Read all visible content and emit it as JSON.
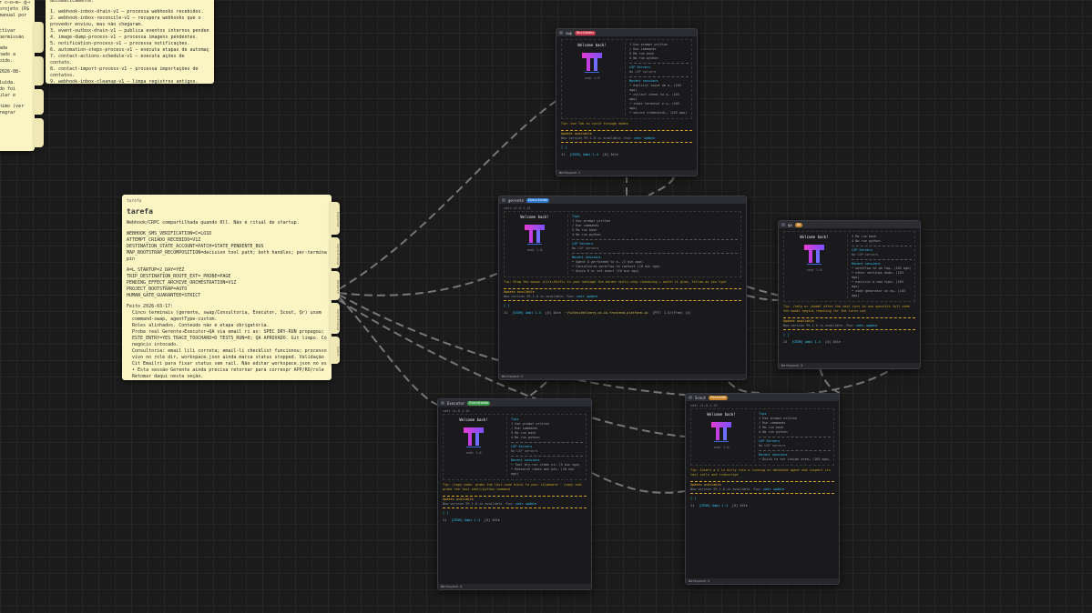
{
  "note_top_left": {
    "lines": [
      "r c̶o̶m̶ ĝ̶e̶ e",
      "projeto (R$,",
      "manual por",
      "",
      "",
      "ctivar",
      "permissão",
      "",
      "ada",
      "nado a",
      "pido.",
      "",
      "2026-08-",
      "",
      "luída.",
      "do foi",
      "ular e",
      "",
      "nimo (ver",
      "regrar"
    ]
  },
  "note_top": {
    "lines": [
      "automaticamente.",
      "",
      "1. webhook-inbox-drain-v1 — processa webhooks recebidos.",
      "2. webhook-inbox-reconcile-v1 — recupera webhooks que o",
      "provedor enviou, mas não chegaram.",
      "3. event-outbox-drain-v1 — publica eventos internos pendentes.",
      "4. image-dump-process-v1 — processa imagens pendentes.",
      "5. notification-process-v1 — processa notificações.",
      "6. automation-steps-process-v1 — executa etapas de automação.",
      "7. contact-actions-schedule-v1 — executa ações de",
      "contato.",
      "8. contact-import-process-v1 — processa importações de",
      "contatos.",
      "9. webhook-inbox-cleanup-v1 — limpa registros antigos."
    ]
  },
  "note_main": {
    "label": "tarefa",
    "title": "tarefa",
    "blocks": [
      [
        "Webhook/CRPC compartilhada quando 0ll. Não é ritual de startup."
      ],
      [
        "WEBHOOK_SMS_VERIFICATION=C=LO1D",
        "ATTEMPT_CRIADO_RECEBIDO=V1Z",
        "DESTINATION_STATE_ACCOUNT=PATCH=STATE_PENDENTE_BUS",
        "MAP_BOOTSTRAP_RECOMPOSITION=decision tool path; both handles; per-terminal model",
        "pin"
      ],
      [
        "A=L_STARTUP=2_DAY=YEZ",
        "TRIP_DESTINATION_ROUTE_EXT=_PROBE=PAGE",
        "PENDING_EFFECT_ARCHIVE_ORCHESTRATION=V1Z",
        "PROJECT_BOOTSTRAP=AUTO",
        "HUMAN_GATE_GUARANTEE=STRICT"
      ],
      [
        "Feito 2026-03-17:",
        "  Cinco terminais (gerente, swap/Consultoria, Executor, Scout, Qr) usam",
        "  command-swap, agentType-custom.",
        "  Roles alinhados. Conteúdo não é etapa obrigatória.",
        "  Probe real Gerente→Executor→QA via email ri as: SPEC DRY-RUN propagou; Executor",
        "  ESTE_ENTRY=YES TRACE_TOOCHARD=D TESTS_RUN=0; QA APROVADO. Git limpo. Código de",
        "  negócio intocado.",
        "  Consultoria: email lili correta; email-li checklist funcionou; processo QAP",
        "  vivo no role dir, workspace.json ainda marca status stopped. Validação clara. Sem",
        "  Cit Emailri para fixar status sem rail. Não editar workspace.json no escuro.",
        "  • Esta sessão Gerente ainda precisa retornar para correspr APP/RO/role finais.",
        "  Retomar daqui nesta seção."
      ]
    ],
    "tabs": [
      "Executor",
      "Consultoria",
      "Gerente",
      "Consultoria",
      "Scout"
    ]
  },
  "terminals": [
    {
      "id": "term-swp",
      "title": "swp",
      "badge": "Novidades",
      "badge_color": "red",
      "version": "",
      "welcome": "Welcome back!",
      "model": "cedr 1.0",
      "tips_title": "",
      "tips": [
        "1 Use prompt written",
        "/ Run commands",
        "3 Mo run bash",
        "4 No run python"
      ],
      "lsp_title": "LSP Servers",
      "lsp": "No LSP servers",
      "recent_title": "Recent sessions",
      "recent": [
        "• explicit input do o… (103 ago)",
        "• collect items to e… (163 ago)",
        "• index terminal e n… (163 ago)",
        "• secure credential… (163 ago)"
      ],
      "tip": "Tip: Use Tab to cycle through modes",
      "update_h": "Update available",
      "update_b": "New version 99.1.0 is available. Run:",
      "update_cmd": "cedr update",
      "status": [
        "J1",
        "[CEDR] Ambi 1.4",
        "[U] Idle"
      ],
      "footer": "Workspace-1"
    },
    {
      "id": "term-gerente",
      "title": "gerente",
      "badge": "Executando",
      "badge_color": "blue",
      "version": "cedr v1.0.1-15",
      "welcome": "Welcome back!",
      "model": "cedr 1.0",
      "tips_title": "Tips",
      "tips": [
        "1 Use prompt written",
        "/ Run commands",
        "3 Mo run bash",
        "4 No run python"
      ],
      "lsp_title": "LSP Servers",
      "lsp": "No LSP servers",
      "recent_title": "Recent sessions",
      "recent": [
        "• Agent A performed to e… (5 min ago)",
        "• Consultoria workflow to context (10 min ago)",
        "• Quick R or set exact (10 min ago)"
      ],
      "tip": "Tip: Drag the mouse +Ctrl+Shift+ in your message the border multi-step reasoning + watch it glow, follow as you type",
      "update_h": "Update available",
      "update_b": "New version 99.1.0 is available. Run:",
      "update_cmd": "cedr update",
      "status": [
        "J1",
        "[CEDR] Ambi 1.4",
        "[U] Idle",
        "~/sites/delivery-os-io-frontend-platform.io",
        "[PTT: 1.5/(Free) (4)"
      ],
      "footer": "Workspace-2"
    },
    {
      "id": "term-qa",
      "title": "qa",
      "badge": "QA",
      "badge_color": "orange",
      "version": "",
      "welcome": "Welcome back!",
      "model": "cedr 1.0",
      "tips_title": "",
      "tips": [
        "3 Mo run bash",
        "4 No run python"
      ],
      "lsp_title": "LSP Servers",
      "lsp": "No LSP servers",
      "recent_title": "Recent sessions",
      "recent": [
        "• workflow to do tag… (103 ago)",
        "• other settings mode… (163 ago)",
        "• explicit a new type… (163 ago)",
        "• code generator un no… (163 ago)"
      ],
      "tip": "Tip: /help or /model after the next turn to use specific full when the model begins reaching for the turns use",
      "update_h": "Update available",
      "update_b": "New version 99.1.0 is available. Run:",
      "update_cmd": "cedr update",
      "status": [
        "J1",
        "[CEDR] Ambi 1.4",
        "[U] Idle"
      ],
      "footer": "Workspace-3"
    },
    {
      "id": "term-executor",
      "title": "Executor",
      "badge": "Executando",
      "badge_color": "green",
      "version": "cedr v1.0.1-15",
      "welcome": "Welcome back!",
      "model": "cedr 1.0",
      "tips_title": "Tips",
      "tips": [
        "1 Use prompt written",
        "/ Run commands",
        "3 Mo run bash",
        "4 No run python"
      ],
      "lsp_title": "LSP Servers",
      "lsp": "No LSP servers",
      "recent_title": "Recent sessions",
      "recent": [
        "• Tool dry-run items st… (5 min ago)",
        "• Research rakes mes pal… (10 min ago)"
      ],
      "tip": "Tip: /copy code: grabs the last code block to your clipboard · /copy cmd: grabs the last shell/python command",
      "update_h": "Update available",
      "update_b": "New version 99.1.0 is available. Run:",
      "update_cmd": "cedr update",
      "status": [
        "J1",
        "[CEDR] Ambi 1.4",
        "[U] Idle"
      ],
      "footer": "Workspace-4"
    },
    {
      "id": "term-scout",
      "title": "Scout",
      "badge": "Pensando",
      "badge_color": "orange",
      "version": "cedr v1.0.1-15",
      "welcome": "Welcome back!",
      "model": "cedr 1.0",
      "tips_title": "Tips",
      "tips": [
        "1 Use prompt written",
        "/ Run commands",
        "3 Mo run bash",
        "4 No run python"
      ],
      "lsp_title": "LSP Servers",
      "lsp": "No LSP servers",
      "recent_title": "Recent sessions",
      "recent": [
        "• Quick to ret inside area… (103 ago)"
      ],
      "tip": "Tip: Insert a 4 to dirty into a running or detached agent and inspect its tool calls and transcript",
      "update_h": "Update available",
      "update_b": "New version 99.1.0 is available. Run:",
      "update_cmd": "cedr update",
      "status": [
        "J1",
        "[CEDR] Ambi 1.4",
        "[U] Idle"
      ],
      "footer": "Workspace-5"
    }
  ],
  "colors": {
    "accent": "#37c0f0",
    "update": "#e7b22e",
    "note": "#fbf5c4",
    "link": "#8a8a8a"
  }
}
